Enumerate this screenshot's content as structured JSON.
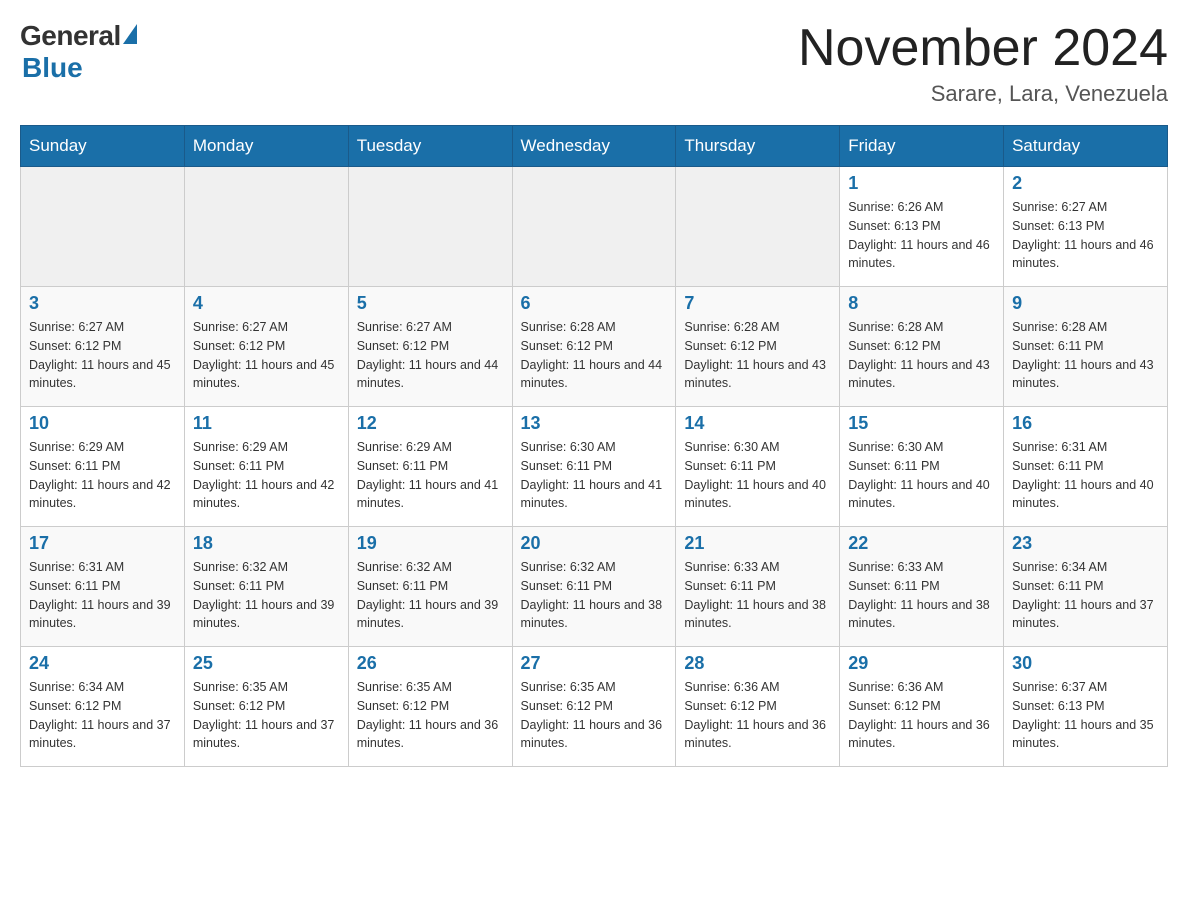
{
  "header": {
    "logo_general": "General",
    "logo_blue": "Blue",
    "month_title": "November 2024",
    "subtitle": "Sarare, Lara, Venezuela"
  },
  "days_of_week": [
    "Sunday",
    "Monday",
    "Tuesday",
    "Wednesday",
    "Thursday",
    "Friday",
    "Saturday"
  ],
  "weeks": [
    [
      {
        "day": "",
        "info": ""
      },
      {
        "day": "",
        "info": ""
      },
      {
        "day": "",
        "info": ""
      },
      {
        "day": "",
        "info": ""
      },
      {
        "day": "",
        "info": ""
      },
      {
        "day": "1",
        "info": "Sunrise: 6:26 AM\nSunset: 6:13 PM\nDaylight: 11 hours and 46 minutes."
      },
      {
        "day": "2",
        "info": "Sunrise: 6:27 AM\nSunset: 6:13 PM\nDaylight: 11 hours and 46 minutes."
      }
    ],
    [
      {
        "day": "3",
        "info": "Sunrise: 6:27 AM\nSunset: 6:12 PM\nDaylight: 11 hours and 45 minutes."
      },
      {
        "day": "4",
        "info": "Sunrise: 6:27 AM\nSunset: 6:12 PM\nDaylight: 11 hours and 45 minutes."
      },
      {
        "day": "5",
        "info": "Sunrise: 6:27 AM\nSunset: 6:12 PM\nDaylight: 11 hours and 44 minutes."
      },
      {
        "day": "6",
        "info": "Sunrise: 6:28 AM\nSunset: 6:12 PM\nDaylight: 11 hours and 44 minutes."
      },
      {
        "day": "7",
        "info": "Sunrise: 6:28 AM\nSunset: 6:12 PM\nDaylight: 11 hours and 43 minutes."
      },
      {
        "day": "8",
        "info": "Sunrise: 6:28 AM\nSunset: 6:12 PM\nDaylight: 11 hours and 43 minutes."
      },
      {
        "day": "9",
        "info": "Sunrise: 6:28 AM\nSunset: 6:11 PM\nDaylight: 11 hours and 43 minutes."
      }
    ],
    [
      {
        "day": "10",
        "info": "Sunrise: 6:29 AM\nSunset: 6:11 PM\nDaylight: 11 hours and 42 minutes."
      },
      {
        "day": "11",
        "info": "Sunrise: 6:29 AM\nSunset: 6:11 PM\nDaylight: 11 hours and 42 minutes."
      },
      {
        "day": "12",
        "info": "Sunrise: 6:29 AM\nSunset: 6:11 PM\nDaylight: 11 hours and 41 minutes."
      },
      {
        "day": "13",
        "info": "Sunrise: 6:30 AM\nSunset: 6:11 PM\nDaylight: 11 hours and 41 minutes."
      },
      {
        "day": "14",
        "info": "Sunrise: 6:30 AM\nSunset: 6:11 PM\nDaylight: 11 hours and 40 minutes."
      },
      {
        "day": "15",
        "info": "Sunrise: 6:30 AM\nSunset: 6:11 PM\nDaylight: 11 hours and 40 minutes."
      },
      {
        "day": "16",
        "info": "Sunrise: 6:31 AM\nSunset: 6:11 PM\nDaylight: 11 hours and 40 minutes."
      }
    ],
    [
      {
        "day": "17",
        "info": "Sunrise: 6:31 AM\nSunset: 6:11 PM\nDaylight: 11 hours and 39 minutes."
      },
      {
        "day": "18",
        "info": "Sunrise: 6:32 AM\nSunset: 6:11 PM\nDaylight: 11 hours and 39 minutes."
      },
      {
        "day": "19",
        "info": "Sunrise: 6:32 AM\nSunset: 6:11 PM\nDaylight: 11 hours and 39 minutes."
      },
      {
        "day": "20",
        "info": "Sunrise: 6:32 AM\nSunset: 6:11 PM\nDaylight: 11 hours and 38 minutes."
      },
      {
        "day": "21",
        "info": "Sunrise: 6:33 AM\nSunset: 6:11 PM\nDaylight: 11 hours and 38 minutes."
      },
      {
        "day": "22",
        "info": "Sunrise: 6:33 AM\nSunset: 6:11 PM\nDaylight: 11 hours and 38 minutes."
      },
      {
        "day": "23",
        "info": "Sunrise: 6:34 AM\nSunset: 6:11 PM\nDaylight: 11 hours and 37 minutes."
      }
    ],
    [
      {
        "day": "24",
        "info": "Sunrise: 6:34 AM\nSunset: 6:12 PM\nDaylight: 11 hours and 37 minutes."
      },
      {
        "day": "25",
        "info": "Sunrise: 6:35 AM\nSunset: 6:12 PM\nDaylight: 11 hours and 37 minutes."
      },
      {
        "day": "26",
        "info": "Sunrise: 6:35 AM\nSunset: 6:12 PM\nDaylight: 11 hours and 36 minutes."
      },
      {
        "day": "27",
        "info": "Sunrise: 6:35 AM\nSunset: 6:12 PM\nDaylight: 11 hours and 36 minutes."
      },
      {
        "day": "28",
        "info": "Sunrise: 6:36 AM\nSunset: 6:12 PM\nDaylight: 11 hours and 36 minutes."
      },
      {
        "day": "29",
        "info": "Sunrise: 6:36 AM\nSunset: 6:12 PM\nDaylight: 11 hours and 36 minutes."
      },
      {
        "day": "30",
        "info": "Sunrise: 6:37 AM\nSunset: 6:13 PM\nDaylight: 11 hours and 35 minutes."
      }
    ]
  ]
}
